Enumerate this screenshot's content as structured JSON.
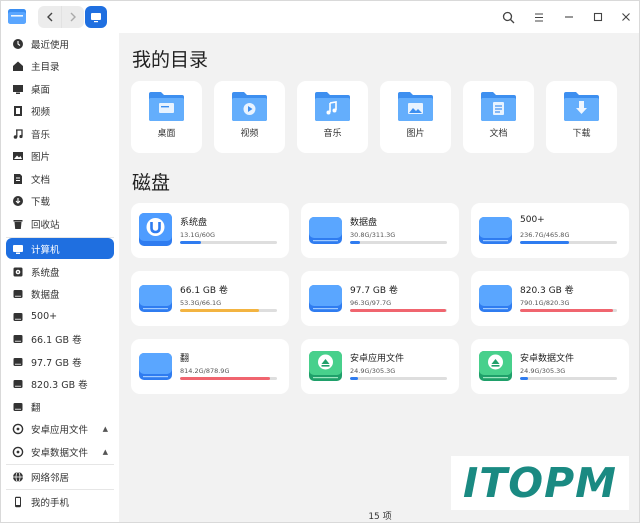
{
  "header": {
    "back_icon": "chevron-left-icon",
    "forward_icon": "chevron-right-icon",
    "search_icon": "search-icon",
    "menu_icon": "hamburger-menu-icon",
    "minimize_icon": "minimize-icon",
    "maximize_icon": "maximize-icon",
    "close_icon": "close-icon"
  },
  "sidebar": {
    "items": [
      {
        "label": "最近使用",
        "icon": "clock-icon"
      },
      {
        "label": "主目录",
        "icon": "home-icon"
      },
      {
        "label": "桌面",
        "icon": "desktop-icon"
      },
      {
        "label": "视频",
        "icon": "video-icon"
      },
      {
        "label": "音乐",
        "icon": "music-icon"
      },
      {
        "label": "图片",
        "icon": "picture-icon"
      },
      {
        "label": "文档",
        "icon": "document-icon"
      },
      {
        "label": "下载",
        "icon": "download-icon"
      },
      {
        "label": "回收站",
        "icon": "trash-icon"
      },
      {
        "label": "计算机",
        "icon": "computer-icon",
        "active": true
      },
      {
        "label": "系统盘",
        "icon": "drive-icon"
      },
      {
        "label": "数据盘",
        "icon": "drive-icon"
      },
      {
        "label": "500+",
        "icon": "drive-icon"
      },
      {
        "label": "66.1 GB 卷",
        "icon": "drive-icon"
      },
      {
        "label": "97.7 GB 卷",
        "icon": "drive-icon"
      },
      {
        "label": "820.3 GB 卷",
        "icon": "drive-icon"
      },
      {
        "label": "翻",
        "icon": "drive-icon"
      },
      {
        "label": "安卓应用文件",
        "icon": "android-icon",
        "eject": true
      },
      {
        "label": "安卓数据文件",
        "icon": "android-icon",
        "eject": true
      },
      {
        "label": "网络邻居",
        "icon": "network-icon"
      },
      {
        "label": "我的手机",
        "icon": "phone-icon"
      }
    ],
    "eject_glyph": "▲"
  },
  "main": {
    "dirs_title": "我的目录",
    "dirs": [
      {
        "label": "桌面",
        "icon": "desktop-folder-icon"
      },
      {
        "label": "视频",
        "icon": "video-folder-icon"
      },
      {
        "label": "音乐",
        "icon": "music-folder-icon"
      },
      {
        "label": "图片",
        "icon": "picture-folder-icon"
      },
      {
        "label": "文档",
        "icon": "document-folder-icon"
      },
      {
        "label": "下载",
        "icon": "download-folder-icon"
      }
    ],
    "disks_title": "磁盘",
    "disks": [
      {
        "name": "系统盘",
        "size": "13.1G/60G",
        "usage": 0.22,
        "color": "#2f7cf0",
        "icon": "system-disk-icon"
      },
      {
        "name": "数据盘",
        "size": "30.8G/311.3G",
        "usage": 0.1,
        "color": "#2f7cf0",
        "icon": "disk-icon"
      },
      {
        "name": "500+",
        "size": "236.7G/465.8G",
        "usage": 0.51,
        "color": "#2f7cf0",
        "icon": "disk-icon"
      },
      {
        "name": "66.1 GB 卷",
        "size": "53.3G/66.1G",
        "usage": 0.81,
        "color": "#f3b441",
        "icon": "disk-icon"
      },
      {
        "name": "97.7 GB 卷",
        "size": "96.3G/97.7G",
        "usage": 0.985,
        "color": "#f0656f",
        "icon": "disk-icon"
      },
      {
        "name": "820.3 GB 卷",
        "size": "790.1G/820.3G",
        "usage": 0.963,
        "color": "#f0656f",
        "icon": "disk-icon"
      },
      {
        "name": "翻",
        "size": "814.2G/878.9G",
        "usage": 0.926,
        "color": "#f0656f",
        "icon": "disk-icon"
      },
      {
        "name": "安卓应用文件",
        "size": "24.9G/305.3G",
        "usage": 0.08,
        "color": "#2f7cf0",
        "icon": "android-disk-icon"
      },
      {
        "name": "安卓数据文件",
        "size": "24.9G/305.3G",
        "usage": 0.08,
        "color": "#2f7cf0",
        "icon": "android-disk-icon"
      }
    ],
    "status": "15 项"
  },
  "watermark": "ITOPM",
  "colors": {
    "accent": "#1f6fe0",
    "background": "#f2f2f2"
  }
}
